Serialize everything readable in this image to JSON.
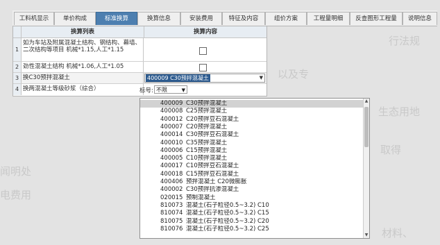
{
  "tabs": [
    {
      "label": "工料机显示",
      "active": false
    },
    {
      "label": "单价构成",
      "active": false
    },
    {
      "label": "标准换算",
      "active": true
    },
    {
      "label": "换算信息",
      "active": false
    },
    {
      "label": "安装费用",
      "active": false
    },
    {
      "label": "特征及内容",
      "active": false
    },
    {
      "label": "组价方案",
      "active": false
    },
    {
      "label": "工程量明细",
      "active": false
    },
    {
      "label": "反查图形工程量",
      "active": false
    },
    {
      "label": "说明信息",
      "active": false
    }
  ],
  "table": {
    "col_list": "换算列表",
    "col_content": "换算内容",
    "rows": [
      {
        "index": "1",
        "name": "如为车站及附属混凝土结构、钢结构、幕墙、二次结构等项目 机械*1.15,人工*1.15",
        "control": "checkbox"
      },
      {
        "index": "2",
        "name": "劲性混凝土结构 机械*1.06,人工*1.05",
        "control": "checkbox"
      },
      {
        "index": "3",
        "name": "换C30预拌混凝土",
        "control": "combo",
        "value": "400009  C30预拌混凝土"
      },
      {
        "index": "4",
        "name": "换两混凝土等级砂浆（综合）",
        "control": "none"
      }
    ]
  },
  "filter": {
    "label": "标号:",
    "value": "不限"
  },
  "dropdown_items": [
    {
      "code": "400009",
      "name": "C30预拌混凝土",
      "selected": true
    },
    {
      "code": "400008",
      "name": "C25预拌混凝土"
    },
    {
      "code": "400012",
      "name": "C20预拌豆石混凝土"
    },
    {
      "code": "400007",
      "name": "C20预拌混凝土"
    },
    {
      "code": "400014",
      "name": "C30预拌豆石混凝土"
    },
    {
      "code": "400010",
      "name": "C35预拌混凝土"
    },
    {
      "code": "400006",
      "name": "C15预拌混凝土"
    },
    {
      "code": "400005",
      "name": "C10预拌混凝土"
    },
    {
      "code": "400017",
      "name": "C10预拌豆石混凝土"
    },
    {
      "code": "400018",
      "name": "C15预拌豆石混凝土"
    },
    {
      "code": "400406",
      "name": "预拌混凝土 C20微膨胀"
    },
    {
      "code": "400002",
      "name": "C30预拌抗渗混凝土"
    },
    {
      "code": "020015",
      "name": "预制混凝土"
    },
    {
      "code": "810073",
      "name": "混凝土(石子粒径0.5~3.2) C10"
    },
    {
      "code": "810074",
      "name": "混凝土(石子粒径0.5~3.2) C15"
    },
    {
      "code": "810075",
      "name": "混凝土(石子粒径0.5~3.2) C20"
    },
    {
      "code": "810076",
      "name": "混凝土(石子粒径0.5~3.2) C25"
    }
  ],
  "background_text": [
    "行法规",
    "以及专",
    "生态用地",
    "取得",
    "闻明处",
    "电费用",
    "材料、"
  ],
  "colors": {
    "active_tab": "#4d7fb0",
    "selection": "#2d5b8f"
  }
}
